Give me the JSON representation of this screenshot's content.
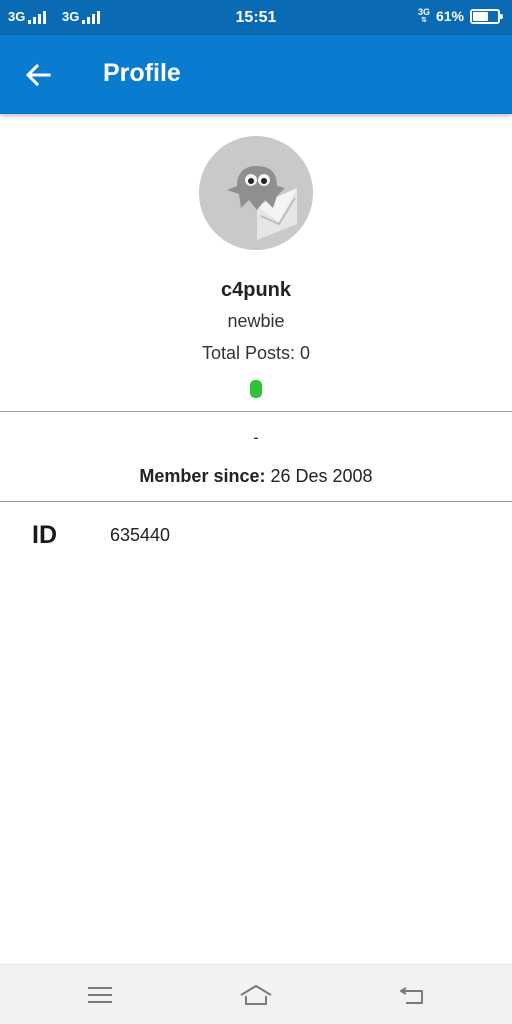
{
  "status_bar": {
    "sim1": "3G",
    "sim2": "3G",
    "time": "15:51",
    "data_indicator": "3G",
    "battery_percent": "61%",
    "battery_level": 0.61,
    "icons": [
      "signal-icon",
      "signal-icon",
      "mobile-data-icon",
      "battery-icon"
    ]
  },
  "app_bar": {
    "title": "Profile",
    "back_icon": "arrow-left-icon"
  },
  "profile": {
    "avatar_icon": "ghost-in-box-avatar",
    "username": "c4punk",
    "rank": "newbie",
    "total_posts": "Total Posts: 0",
    "online_status_color": "#2ec13a",
    "bio": "-",
    "member_since_label": "Member since:",
    "member_since_value": "26 Des 2008",
    "id_label": "ID",
    "id_value": "635440"
  },
  "nav_bar": {
    "icons": [
      "menu-icon",
      "home-icon",
      "back-icon"
    ]
  },
  "colors": {
    "status_bar": "#0a6ab3",
    "app_bar": "#0a7cd0",
    "avatar_bg": "#c9c9c9"
  }
}
